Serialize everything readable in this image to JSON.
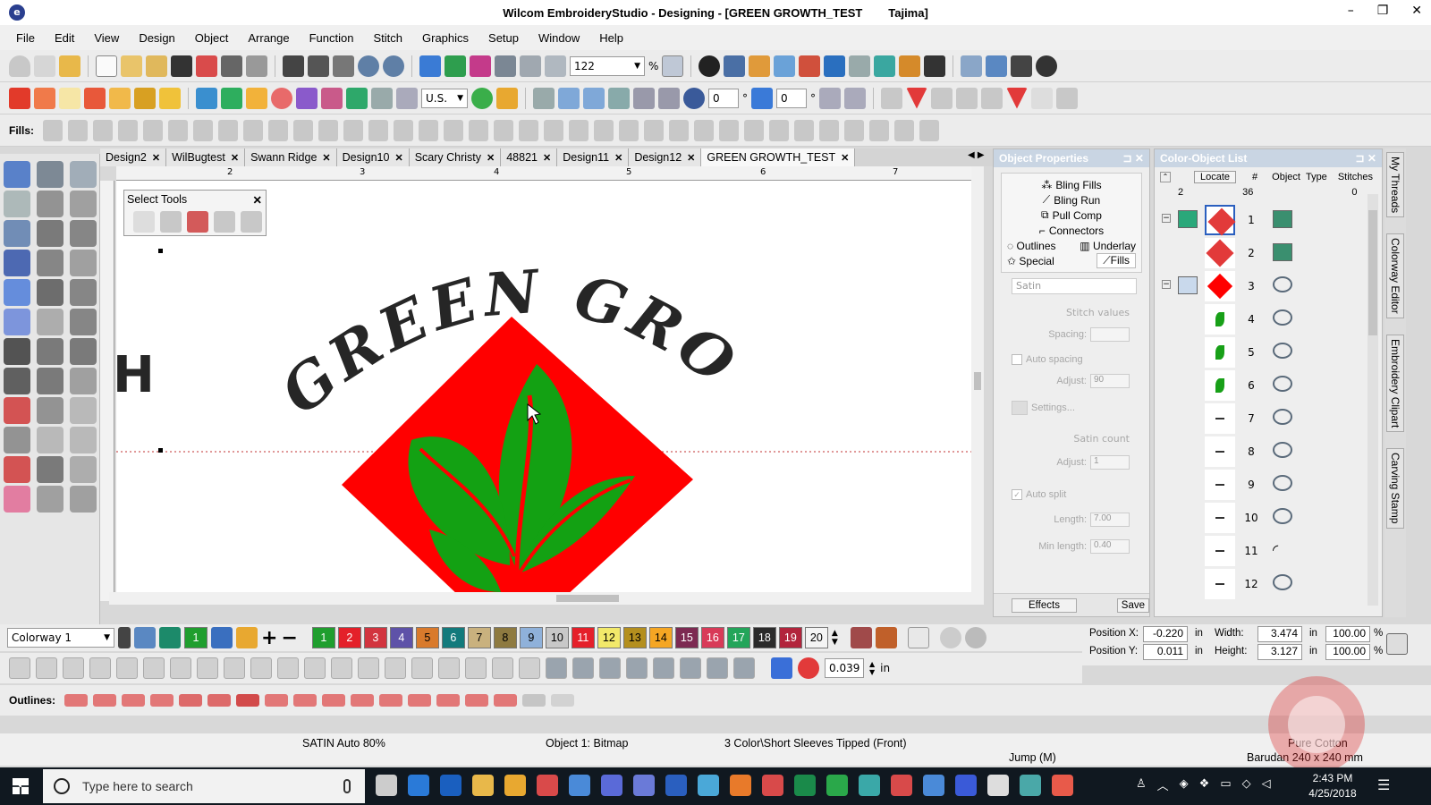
{
  "window": {
    "title": "Wilcom EmbroideryStudio - Designing - [GREEN GROWTH_TEST        Tajima]",
    "minimize": "–",
    "restore": "❐",
    "close": "✕"
  },
  "menu": [
    "File",
    "Edit",
    "View",
    "Design",
    "Object",
    "Arrange",
    "Function",
    "Stitch",
    "Graphics",
    "Setup",
    "Window",
    "Help"
  ],
  "toolbar1": {
    "zoom_value": "122",
    "zoom_unit": "%"
  },
  "toolbar2": {
    "units_value": "U.S.",
    "rotate_value": "0",
    "slant_value": "0",
    "deg_symbol": "°"
  },
  "fills_label": "Fills:",
  "outlines_label": "Outlines:",
  "tabs": [
    {
      "label": "Design2",
      "active": false
    },
    {
      "label": "WilBugtest",
      "active": false
    },
    {
      "label": "Swann Ridge",
      "active": false
    },
    {
      "label": "Design10",
      "active": false
    },
    {
      "label": "Scary Christy",
      "active": false
    },
    {
      "label": "48821",
      "active": false
    },
    {
      "label": "Design11",
      "active": false
    },
    {
      "label": "Design12",
      "active": false
    },
    {
      "label": "GREEN GROWTH_TEST",
      "active": true
    }
  ],
  "tab_close": "✕",
  "ruler_marks": [
    "2",
    "3",
    "4",
    "5",
    "6",
    "7"
  ],
  "select_tools": {
    "title": "Select Tools",
    "close": "✕"
  },
  "canvas": {
    "arc_text": "GREEN GROWTH",
    "edge_text": "H",
    "colors": {
      "red": "#ff0000",
      "green": "#13a113",
      "text": "#262626"
    }
  },
  "object_properties": {
    "title": "Object Properties",
    "tabs": [
      "Bling Fills",
      "Bling Run",
      "Pull Comp",
      "Connectors",
      "Outlines",
      "Underlay",
      "Special",
      "Fills"
    ],
    "fill_type": "Satin",
    "stitch_values_label": "Stitch values",
    "spacing_label": "Spacing:",
    "auto_spacing_label": "Auto spacing",
    "adjust_label": "Adjust:",
    "adjust_value": "90",
    "settings_label": "Settings...",
    "satin_count_label": "Satin count",
    "satin_adjust_value": "1",
    "auto_split_label": "Auto split",
    "length_label": "Length:",
    "length_value": "7.00",
    "min_length_label": "Min length:",
    "min_length_value": "0.40",
    "effects_button": "Effects",
    "save_button": "Save"
  },
  "color_object_list": {
    "title": "Color-Object List",
    "locate_button": "Locate",
    "col_num": "#",
    "col_object": "Object",
    "col_type": "Type",
    "col_stitches": "Stitches",
    "summary_colors": "2",
    "summary_objects": "36",
    "summary_stitches": "0",
    "rows": [
      "1",
      "2",
      "3",
      "4",
      "5",
      "6",
      "7",
      "8",
      "9",
      "10",
      "11",
      "12"
    ]
  },
  "side_tabs": [
    "My Threads",
    "Colorway Editor",
    "Embroidery Clipart",
    "Carving Stamp"
  ],
  "colorway": {
    "name": "Colorway 1",
    "current_slot": "1",
    "slots": [
      {
        "n": "1",
        "bg": "#1f9e2e",
        "fg": "#ffffff"
      },
      {
        "n": "2",
        "bg": "#e4202a",
        "fg": "#ffffff"
      },
      {
        "n": "3",
        "bg": "#d2343f",
        "fg": "#ffffff"
      },
      {
        "n": "4",
        "bg": "#5e52a8",
        "fg": "#ffffff"
      },
      {
        "n": "5",
        "bg": "#d97a2c",
        "fg": "#000000"
      },
      {
        "n": "6",
        "bg": "#127a7c",
        "fg": "#ffffff"
      },
      {
        "n": "7",
        "bg": "#c9b17e",
        "fg": "#000000"
      },
      {
        "n": "8",
        "bg": "#8e7a40",
        "fg": "#000000"
      },
      {
        "n": "9",
        "bg": "#8fb1da",
        "fg": "#000000"
      },
      {
        "n": "10",
        "bg": "#c8c8c8",
        "fg": "#000000"
      },
      {
        "n": "11",
        "bg": "#e5202a",
        "fg": "#ffffff"
      },
      {
        "n": "12",
        "bg": "#f2e96a",
        "fg": "#000000"
      },
      {
        "n": "13",
        "bg": "#b48f1e",
        "fg": "#000000"
      },
      {
        "n": "14",
        "bg": "#f5a623",
        "fg": "#000000"
      },
      {
        "n": "15",
        "bg": "#7d2a52",
        "fg": "#ffffff"
      },
      {
        "n": "16",
        "bg": "#d83a58",
        "fg": "#ffffff"
      },
      {
        "n": "17",
        "bg": "#23a55a",
        "fg": "#ffffff"
      },
      {
        "n": "18",
        "bg": "#2b2b2b",
        "fg": "#ffffff"
      },
      {
        "n": "19",
        "bg": "#b2243c",
        "fg": "#ffffff"
      },
      {
        "n": "20",
        "bg": "#f4f4f4",
        "fg": "#000000"
      }
    ]
  },
  "position": {
    "x_label": "Position X:",
    "x_value": "-0.220",
    "x_unit": "in",
    "y_label": "Position Y:",
    "y_value": "0.011",
    "y_unit": "in",
    "w_label": "Width:",
    "w_value": "3.474",
    "w_unit": "in",
    "w_pct": "100.00",
    "w_pct_unit": "%",
    "h_label": "Height:",
    "h_value": "3.127",
    "h_unit": "in",
    "h_pct": "100.00",
    "h_pct_unit": "%"
  },
  "outline_width": {
    "value": "0.039",
    "unit": "in"
  },
  "status": {
    "stitch_type": "SATIN Auto 80%",
    "object": "Object 1: Bitmap",
    "product": "3 Color\\Short Sleeves Tipped (Front)",
    "fabric": "Pure Cotton",
    "mode": "Jump (M)",
    "machine": "Barudan 240 x 240 mm"
  },
  "taskbar": {
    "search_placeholder": "Type here to search",
    "time": "2:43 PM",
    "date": "4/25/2018"
  }
}
